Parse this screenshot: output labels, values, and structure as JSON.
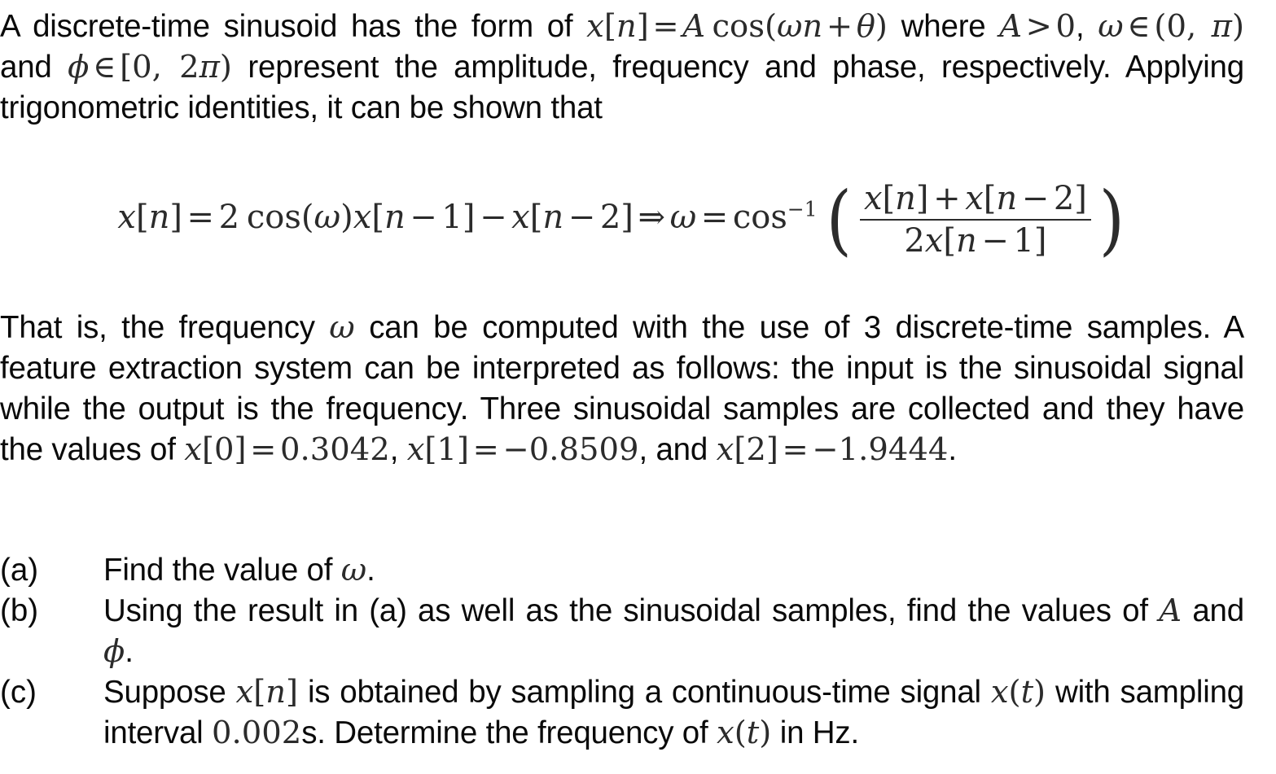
{
  "document": {
    "type": "homework-problem",
    "paragraph1": {
      "seg1": "A discrete-time sinusoid has the form of ",
      "math1": "x[n] = A cos(ωn + θ)",
      "seg2": " where ",
      "math2": "A > 0",
      "seg3": ", ",
      "math3": "ω ∈ (0, π)",
      "seg4": " and ",
      "math4": "ϕ ∈ [0, 2π)",
      "seg5": " represent the amplitude, frequency and phase, respectively. Applying trigonometric identities, it can be shown that"
    },
    "display_equation": {
      "latex": "x[n] = 2\\cos(\\omega)x[n-1] - x[n-2] \\Rightarrow \\omega = \\cos^{-1}\\left(\\frac{x[n]+x[n-2]}{2x[n-1]}\\right)",
      "lhs": "x[n] = 2 cos(ω)x[n − 1] − x[n − 2]",
      "implies": "⇒",
      "rhs_head": "ω = cos",
      "exponent": "−1",
      "paren_left": "(",
      "paren_right": ")",
      "numerator": "x[n] + x[n − 2]",
      "denominator": "2x[n − 1]"
    },
    "paragraph2": {
      "seg1": "That is, the frequency ",
      "math1": "ω",
      "seg2": " can be computed with the use of 3 discrete-time samples. A feature extraction system can be interpreted as follows: the input is the sinusoidal signal while the output is the frequency. Three sinusoidal samples are collected and they have the values of ",
      "math2": "x[0] = 0.3042",
      "seg3": ", ",
      "math3": "x[1] = −0.8509",
      "seg4": ", and ",
      "math4": "x[2] = −1.9444",
      "seg5": "."
    },
    "questions": [
      {
        "label": "(a)",
        "seg1": "Find the value of ",
        "math1": "ω",
        "seg2": "."
      },
      {
        "label": "(b)",
        "seg1": "Using the result in (a) as well as the sinusoidal samples, find the values of ",
        "math1": "A",
        "seg2": " and ",
        "math2": "ϕ",
        "seg3": "."
      },
      {
        "label": "(c)",
        "seg1": "Suppose ",
        "math1": "x[n]",
        "seg2": " is obtained by sampling a continuous-time signal ",
        "math2": "x(t)",
        "seg3": " with sampling interval ",
        "math3": "0.002",
        "seg4": "s. Determine the frequency of ",
        "math4": "x(t)",
        "seg5": " in Hz."
      }
    ],
    "values": {
      "x0": "0.3042",
      "x1": "−0.8509",
      "x2": "−1.9444",
      "sampling_interval_seconds": "0.002",
      "num_samples": "3"
    },
    "colors": {
      "background": "#ffffff",
      "text": "#0a0a0a",
      "math": "#2b2b2b"
    }
  }
}
